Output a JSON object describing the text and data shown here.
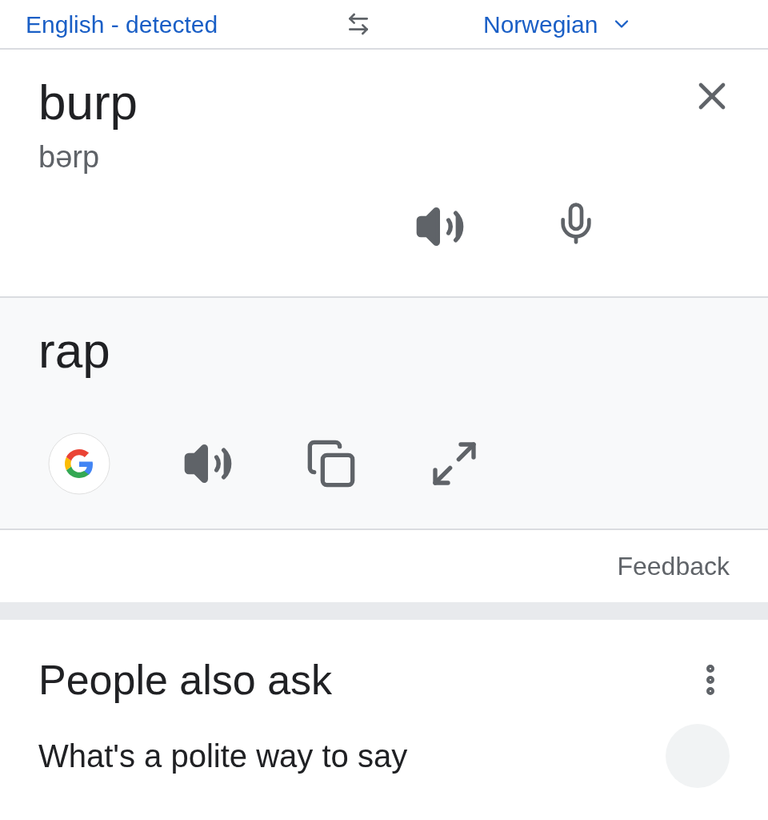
{
  "language_bar": {
    "source_language": "English - detected",
    "target_language": "Norwegian"
  },
  "input": {
    "text": "burp",
    "pronunciation": "bərp"
  },
  "output": {
    "text": "rap"
  },
  "feedback": {
    "label": "Feedback"
  },
  "people_also_ask": {
    "title": "People also ask",
    "questions": [
      "What's a polite way to say"
    ]
  }
}
